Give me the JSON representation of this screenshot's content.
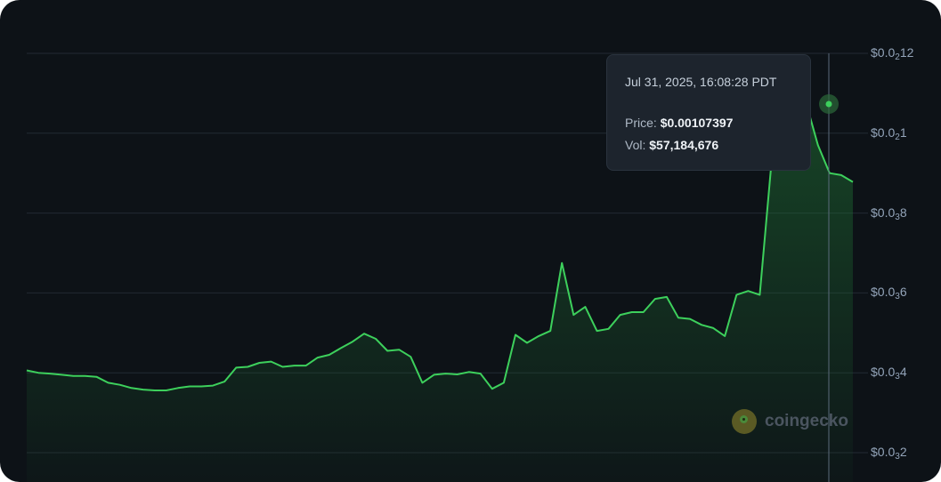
{
  "chart_data": {
    "type": "area",
    "series": [
      {
        "values": [
          0.000406,
          0.0004,
          0.000398,
          0.000395,
          0.000392,
          0.000392,
          0.00039,
          0.000375,
          0.00037,
          0.000362,
          0.000358,
          0.000356,
          0.000356,
          0.000362,
          0.000366,
          0.000366,
          0.000368,
          0.000378,
          0.000413,
          0.000415,
          0.000425,
          0.000428,
          0.000415,
          0.000418,
          0.000418,
          0.000438,
          0.000445,
          0.000462,
          0.000478,
          0.000498,
          0.000485,
          0.000455,
          0.000458,
          0.00044,
          0.000375,
          0.000395,
          0.000398,
          0.000396,
          0.000402,
          0.000398,
          0.00036,
          0.000375,
          0.000495,
          0.000475,
          0.000492,
          0.000505,
          0.000675,
          0.000545,
          0.000565,
          0.000505,
          0.00051,
          0.000545,
          0.000552,
          0.000552,
          0.000585,
          0.00059,
          0.000538,
          0.000535,
          0.00052,
          0.000512,
          0.000492,
          0.000595,
          0.000605,
          0.000595,
          0.000925,
          0.00095,
          0.000955,
          0.00107397,
          0.00097,
          0.0009,
          0.000895,
          0.000878
        ]
      }
    ],
    "y_ticks": [
      {
        "lead": "$0.0",
        "sub": "2",
        "tail": "12",
        "value": 0.0012
      },
      {
        "lead": "$0.0",
        "sub": "2",
        "tail": "1",
        "value": 0.001
      },
      {
        "lead": "$0.0",
        "sub": "3",
        "tail": "8",
        "value": 0.0008
      },
      {
        "lead": "$0.0",
        "sub": "3",
        "tail": "6",
        "value": 0.0006
      },
      {
        "lead": "$0.0",
        "sub": "3",
        "tail": "4",
        "value": 0.0004
      },
      {
        "lead": "$0.0",
        "sub": "3",
        "tail": "2",
        "value": 0.0002
      }
    ],
    "ylim": [
      0.0002,
      0.0012
    ],
    "grid": true,
    "line_color": "#3dd05c",
    "fill_color": "#1f6e33"
  },
  "tooltip": {
    "date": "Jul 31, 2025, 16:08:28 PDT",
    "price_label": "Price:",
    "price_value": "$0.00107397",
    "vol_label": "Vol:",
    "vol_value": "$57,184,676"
  },
  "watermark": {
    "brand": "coingecko"
  }
}
